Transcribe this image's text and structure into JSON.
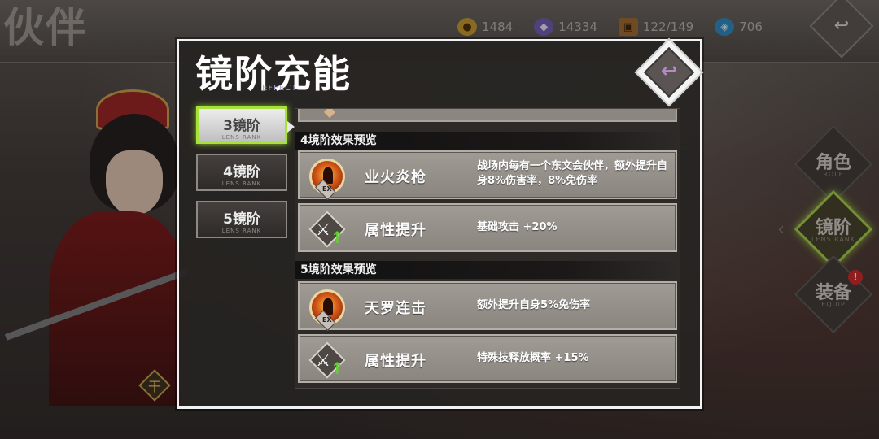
{
  "page": {
    "title": "伙伴"
  },
  "resources": [
    {
      "icon": "gold-coin-icon",
      "value": "1484"
    },
    {
      "icon": "crystal-icon",
      "value": "14334"
    },
    {
      "icon": "chest-icon",
      "value": "122/149"
    },
    {
      "icon": "gem-icon",
      "value": "706"
    }
  ],
  "top_back": {
    "glyph": "↩"
  },
  "side_nav": [
    {
      "label": "角色",
      "sub": "ROLE",
      "active": false,
      "alert": false
    },
    {
      "label": "镜阶",
      "sub": "LENS RANK",
      "active": true,
      "alert": false
    },
    {
      "label": "装备",
      "sub": "EQUIP",
      "active": false,
      "alert": true,
      "alert_text": "!"
    }
  ],
  "character": {
    "badge": "干"
  },
  "modal": {
    "title": "镜阶充能",
    "subtitle": "EFFECT",
    "close_glyph": "↩",
    "tabs": [
      {
        "label": "3镜阶",
        "sub": "LENS RANK",
        "active": true
      },
      {
        "label": "4镜阶",
        "sub": "LENS RANK",
        "active": false
      },
      {
        "label": "5镜阶",
        "sub": "LENS RANK",
        "active": false
      }
    ],
    "sections": [
      {
        "header": "4境阶效果预览",
        "rows": [
          {
            "type": "skill",
            "icon_badge": "EX",
            "name": "业火炎枪",
            "desc": "战场内每有一个东文会伙伴，额外提升自身8%伤害率，8%免伤率"
          },
          {
            "type": "attr",
            "name": "属性提升",
            "desc": "基础攻击 +20%"
          }
        ]
      },
      {
        "header": "5境阶效果预览",
        "rows": [
          {
            "type": "skill",
            "icon_badge": "EX",
            "name": "天罗连击",
            "desc": "额外提升自身5%免伤率"
          },
          {
            "type": "attr",
            "name": "属性提升",
            "desc": "特殊技释放概率 +15%"
          }
        ]
      }
    ]
  }
}
